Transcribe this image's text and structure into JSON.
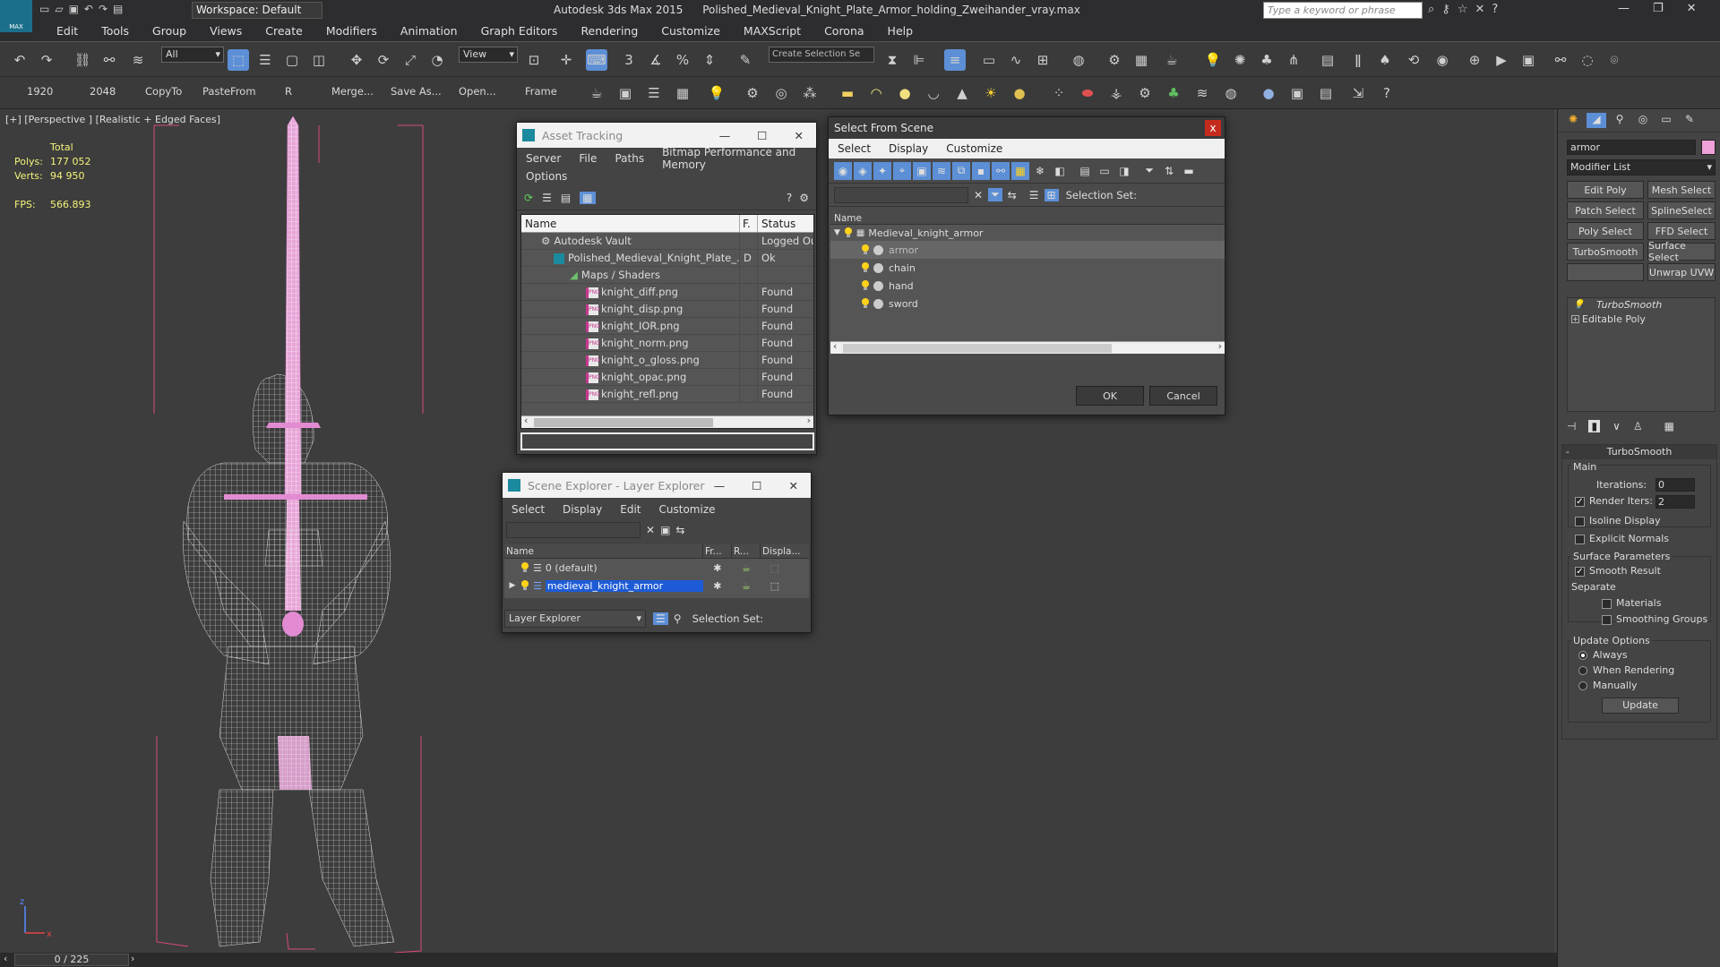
{
  "app": {
    "title": "Autodesk 3ds Max 2015",
    "file": "Polished_Medieval_Knight_Plate_Armor_holding_Zweihander_vray.max",
    "workspace": "Workspace: Default",
    "search_placeholder": "Type a keyword or phrase"
  },
  "menubar": [
    "Edit",
    "Tools",
    "Group",
    "Views",
    "Create",
    "Modifiers",
    "Animation",
    "Graph Editors",
    "Rendering",
    "Customize",
    "MAXScript",
    "Corona",
    "Help"
  ],
  "toolbar": {
    "filter_value": "All",
    "refcoord_value": "View",
    "selection_set_placeholder": "Create Selection Se"
  },
  "toolbar2": {
    "buttons": [
      "1920",
      "2048",
      "CopyTo",
      "PasteFrom",
      "R",
      "Merge...",
      "Save As...",
      "Open...",
      "Frame"
    ]
  },
  "viewport": {
    "label": "[+] [Perspective ] [Realistic + Edged Faces]",
    "stats_header": "Total",
    "polys_label": "Polys:",
    "polys_value": "177 052",
    "verts_label": "Verts:",
    "verts_value": "94 950",
    "fps_label": "FPS:",
    "fps_value": "566.893"
  },
  "asset_tracking": {
    "title": "Asset Tracking",
    "menu": [
      "Server",
      "File",
      "Paths",
      "Bitmap Performance and Memory"
    ],
    "menu2": "Options",
    "columns": [
      "Name",
      "F.",
      "Status"
    ],
    "rows": [
      {
        "name": "Autodesk Vault",
        "f": "",
        "status": "Logged Ou"
      },
      {
        "name": "Polished_Medieval_Knight_Plate_...",
        "f": "D",
        "status": "Ok"
      },
      {
        "name": "Maps / Shaders",
        "f": "",
        "status": ""
      },
      {
        "name": "knight_diff.png",
        "f": "",
        "status": "Found"
      },
      {
        "name": "knight_disp.png",
        "f": "",
        "status": "Found"
      },
      {
        "name": "knight_IOR.png",
        "f": "",
        "status": "Found"
      },
      {
        "name": "knight_norm.png",
        "f": "",
        "status": "Found"
      },
      {
        "name": "knight_o_gloss.png",
        "f": "",
        "status": "Found"
      },
      {
        "name": "knight_opac.png",
        "f": "",
        "status": "Found"
      },
      {
        "name": "knight_refl.png",
        "f": "",
        "status": "Found"
      }
    ]
  },
  "select_from_scene": {
    "title": "Select From Scene",
    "close": "x",
    "menu": [
      "Select",
      "Display",
      "Customize"
    ],
    "selection_set_label": "Selection Set:",
    "column_name": "Name",
    "root": "Medieval_knight_armor",
    "items": [
      "armor",
      "chain",
      "hand",
      "sword"
    ],
    "ok": "OK",
    "cancel": "Cancel"
  },
  "scene_explorer": {
    "title": "Scene Explorer - Layer Explorer",
    "menu": [
      "Select",
      "Display",
      "Edit",
      "Customize"
    ],
    "columns": [
      "Name",
      "Fr...",
      "R...",
      "Displa..."
    ],
    "rows": [
      "0 (default)",
      "medieval_knight_armor"
    ],
    "explorer_type": "Layer Explorer",
    "selection_set_label": "Selection Set:"
  },
  "command_panel": {
    "object_name": "armor",
    "object_color": "#f0a0d8",
    "modifier_list": "Modifier List",
    "modifier_buttons": [
      [
        "Edit Poly",
        "Mesh Select"
      ],
      [
        "Patch Select",
        "SplineSelect"
      ],
      [
        "Poly Select",
        "FFD Select"
      ],
      [
        "TurboSmooth",
        "Surface Select"
      ],
      [
        "",
        "Unwrap UVW"
      ]
    ],
    "stack": [
      "TurboSmooth",
      "Editable Poly"
    ],
    "rollout_title": "TurboSmooth",
    "main_label": "Main",
    "iterations_label": "Iterations:",
    "iterations_value": "0",
    "render_iters_label": "Render Iters:",
    "render_iters_value": "2",
    "isoline_label": "Isoline Display",
    "explicit_label": "Explicit Normals",
    "surface_params_label": "Surface Parameters",
    "smooth_result_label": "Smooth Result",
    "separate_label": "Separate",
    "materials_label": "Materials",
    "smoothing_groups_label": "Smoothing Groups",
    "update_options_label": "Update Options",
    "always_label": "Always",
    "when_rendering_label": "When Rendering",
    "manually_label": "Manually",
    "update_button": "Update"
  },
  "statusbar": {
    "frame": "0 / 225"
  },
  "colors": {
    "highlight": "#1d5bd6",
    "wire_pink": "#e38bd2",
    "bbox_pink": "#d84a7a"
  }
}
